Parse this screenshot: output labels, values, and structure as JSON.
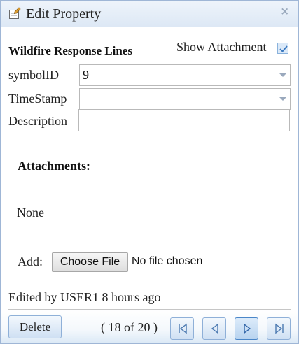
{
  "window": {
    "title": "Edit Property",
    "close_glyph": "×"
  },
  "layer": {
    "name": "Wildfire Response Lines",
    "show_attachments_label": "Show Attachment",
    "show_attachments_checked": true
  },
  "fields": [
    {
      "label": "symbolID",
      "value": "9",
      "type": "select"
    },
    {
      "label": "TimeStamp",
      "value": "",
      "type": "select"
    },
    {
      "label": "Description",
      "value": "",
      "type": "text"
    }
  ],
  "attachments": {
    "heading": "Attachments:",
    "empty_text": "None",
    "add_label": "Add:",
    "choose_file_label": "Choose File",
    "no_file_text": "No file chosen"
  },
  "footer": {
    "edited_text": "Edited by USER1 8 hours ago",
    "delete_label": "Delete",
    "pager_text": "( 18 of 20 )",
    "current_record": 18,
    "total_records": 20,
    "icons": [
      "first-record-icon",
      "previous-record-icon",
      "next-record-icon",
      "last-record-icon"
    ]
  },
  "colors": {
    "titlebar": "#dde8f5",
    "button_border": "#8fb0d8",
    "active_nav_border": "#4a86c8"
  }
}
